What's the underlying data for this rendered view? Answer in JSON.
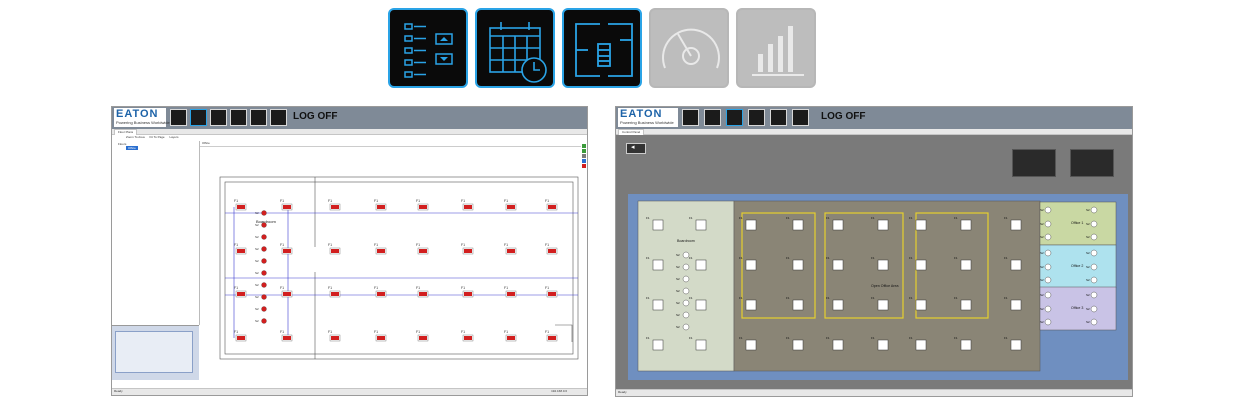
{
  "top_icons": [
    {
      "name": "control-panel-icon",
      "state": "active"
    },
    {
      "name": "calendar-schedule-icon",
      "state": "active"
    },
    {
      "name": "floor-plan-icon",
      "state": "active"
    },
    {
      "name": "gauge-icon",
      "state": "disabled"
    },
    {
      "name": "bar-chart-icon",
      "state": "disabled"
    }
  ],
  "brand": {
    "name": "EATON",
    "tagline": "Powering Business Worldwide"
  },
  "header_icons": [
    "home-icon",
    "floor-plan-icon",
    "control-panel-icon",
    "gauge-icon",
    "bar-chart-icon",
    "calendar-schedule-icon"
  ],
  "left_panel": {
    "logoff_label": "LOG OFF",
    "tab_label": "Floor Plans",
    "toolbar": {
      "zoom_area": "Zoom To Area",
      "fit_page": "Fit To Page",
      "layers": "Layers"
    },
    "tree": {
      "root": "Floors",
      "child": "Office"
    },
    "view_title": "Office",
    "room_label": "Boardroom",
    "fixture_label": "F1",
    "sensor_label": "S2",
    "status_left": "Ready",
    "status_right": "192.168.0.6"
  },
  "right_panel": {
    "logoff_label": "LOG OFF",
    "tab_label": "Control Panel",
    "boardroom_label": "Boardroom",
    "open_office_label": "Open Office Area",
    "office_labels": [
      "Office 1",
      "Office 2",
      "Office 3"
    ],
    "fixture_label": "F1",
    "sensor_label": "S2",
    "status_left": "Ready"
  },
  "colors": {
    "accent": "#2aa3e6",
    "header": "#7f8a97",
    "fixture_red": "#d21f1f",
    "zone_yellow": "#e6cf2e",
    "blue_floor": "#6f8fc0",
    "open_area": "#8a8576",
    "boardroom_green": "#d3dac8",
    "office1": "#c9d8a3",
    "office2": "#aee2ee",
    "office3": "#c9c3e6"
  }
}
